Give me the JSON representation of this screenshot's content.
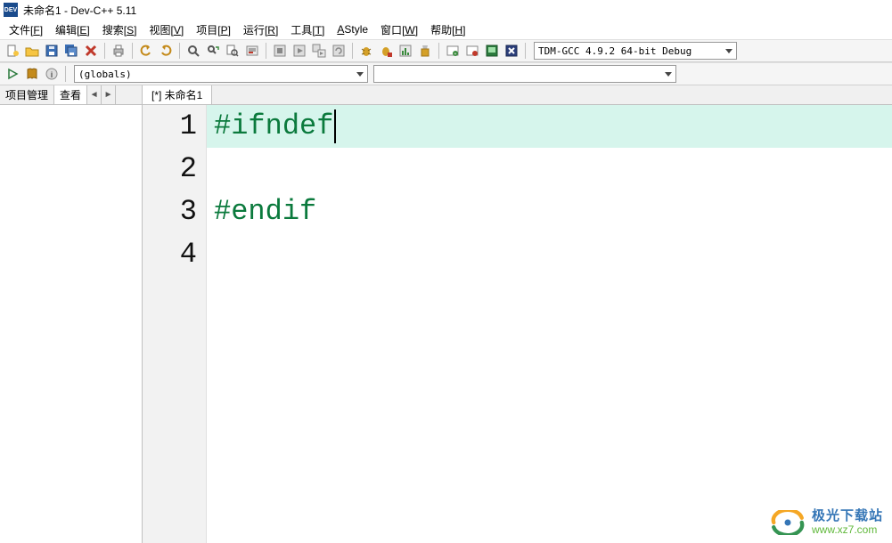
{
  "window": {
    "title": "未命名1 - Dev-C++ 5.11",
    "icon_label": "DEV"
  },
  "menu": {
    "file": {
      "label": "文件",
      "key": "F"
    },
    "edit": {
      "label": "编辑",
      "key": "E"
    },
    "search": {
      "label": "搜索",
      "key": "S"
    },
    "view": {
      "label": "视图",
      "key": "V"
    },
    "project": {
      "label": "项目",
      "key": "P"
    },
    "run": {
      "label": "运行",
      "key": "R"
    },
    "tools": {
      "label": "工具",
      "key": "T"
    },
    "astyle": {
      "label": "AStyle",
      "key": ""
    },
    "window": {
      "label": "窗口",
      "key": "W"
    },
    "help": {
      "label": "帮助",
      "key": "H"
    }
  },
  "toolbar": {
    "compiler_combo": "TDM-GCC 4.9.2 64-bit Debug"
  },
  "toolbar2": {
    "globals_combo": "(globals)",
    "functions_combo": ""
  },
  "sidebar": {
    "tabs": {
      "project": "项目管理",
      "view": "查看",
      "scroll_left": "◄",
      "scroll_right": "►"
    }
  },
  "editor": {
    "tabs": {
      "file1": "[*] 未命名1"
    },
    "lines": [
      {
        "n": "1",
        "text": "#ifndef",
        "current": true,
        "color": "#0b7a3d"
      },
      {
        "n": "2",
        "text": "",
        "current": false,
        "color": "#000"
      },
      {
        "n": "3",
        "text": "#endif",
        "current": false,
        "color": "#0b7a3d"
      },
      {
        "n": "4",
        "text": "",
        "current": false,
        "color": "#000"
      }
    ]
  },
  "watermark": {
    "title": "极光下载站",
    "url": "www.xz7.com"
  }
}
